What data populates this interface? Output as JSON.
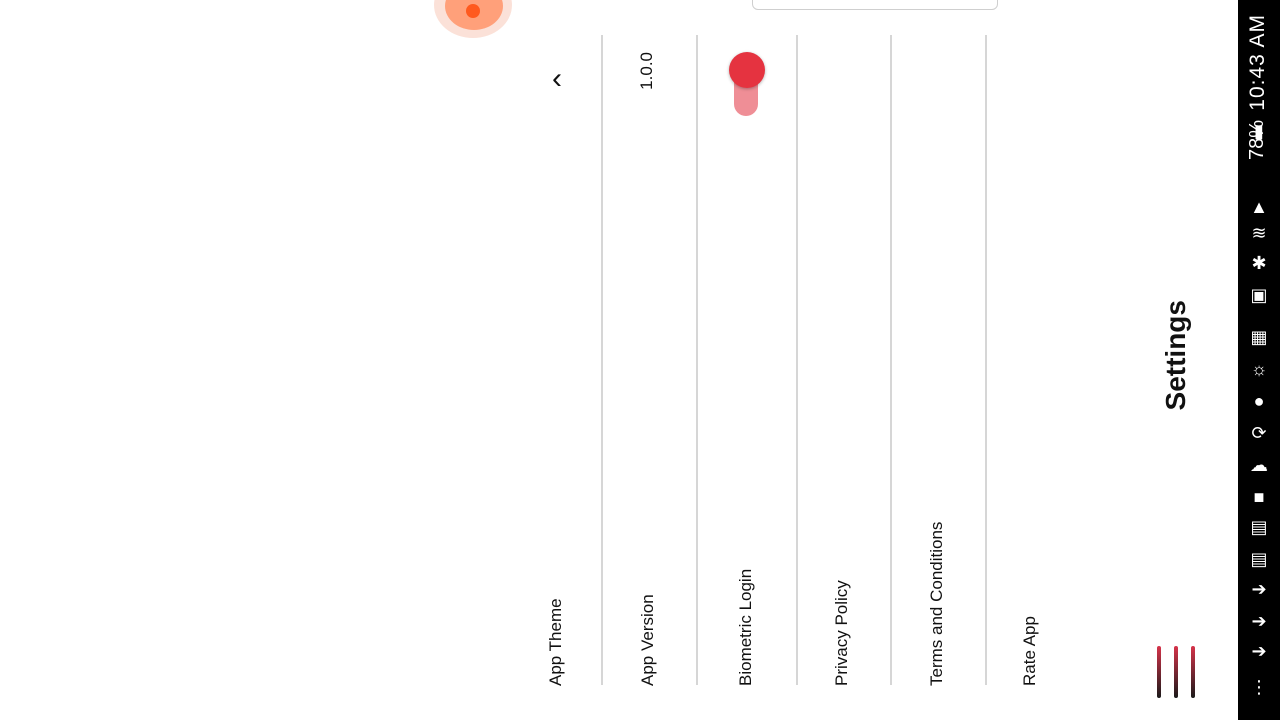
{
  "status_bar": {
    "time": "10:43 AM",
    "battery": "78%",
    "icons": [
      "battery-icon",
      "signal-icon",
      "wifi-icon",
      "bluetooth-icon",
      "cast-icon",
      "nfc-icon",
      "alarm-icon",
      "record-icon",
      "sync-icon",
      "cloud-icon",
      "wallet-icon",
      "news-icon",
      "news-icon",
      "notification-icon",
      "notification-icon",
      "notification-icon",
      "notification-icon",
      "more-icon"
    ]
  },
  "header": {
    "title": "Settings",
    "menu_icon": "menu-icon"
  },
  "settings": {
    "rate_app": "Rate App",
    "terms": "Terms and Conditions",
    "privacy": "Privacy Policy",
    "biometric": "Biometric Login",
    "biometric_enabled": true,
    "app_version_label": "App Version",
    "app_version_value": "1.0.0",
    "app_theme": "App Theme"
  },
  "colors": {
    "accent": "#e53340",
    "accent_light": "#ef8e96",
    "fab": "#ffa07a"
  }
}
